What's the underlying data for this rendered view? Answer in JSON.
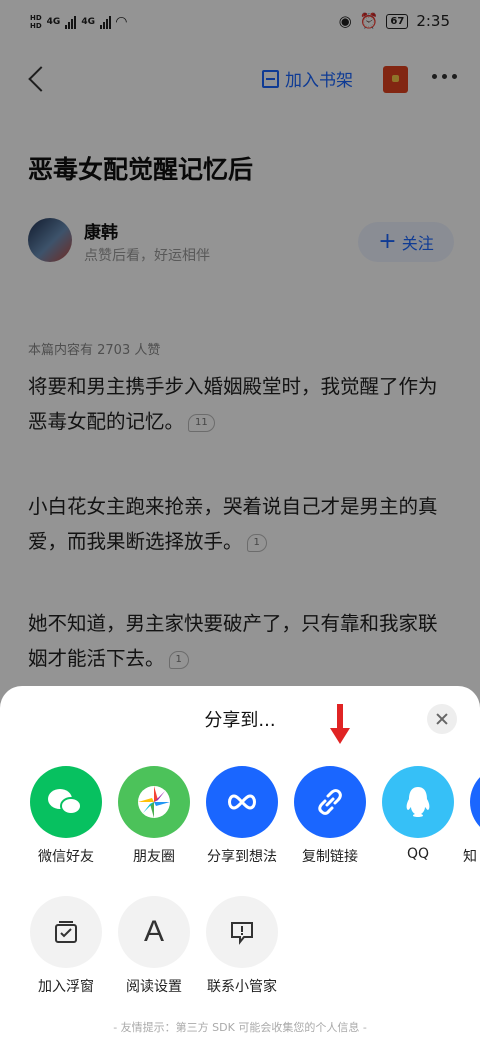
{
  "status_bar": {
    "sim1": "HD",
    "sim2": "HD",
    "net1": "4G",
    "net2": "4G",
    "battery": "67",
    "time": "2:35"
  },
  "nav": {
    "bookshelf_label": "加入书架"
  },
  "article": {
    "title": "恶毒女配觉醒记忆后",
    "author_name": "康韩",
    "author_sub": "点赞后看，好运相伴",
    "follow_label": "关注",
    "likes_text": "本篇内容有 2703 人赞",
    "paragraphs": [
      {
        "text": "将要和男主携手步入婚姻殿堂时，我觉醒了作为恶毒女配的记忆。",
        "comments": "11"
      },
      {
        "text": "小白花女主跑来抢亲，哭着说自己才是男主的真爱，而我果断选择放手。",
        "comments": "1"
      },
      {
        "text": "她不知道，男主家快要破产了，只有靠和我家联姻才能活下去。",
        "comments": "1"
      }
    ]
  },
  "share_sheet": {
    "title": "分享到...",
    "share_items": [
      {
        "label": "微信好友",
        "color": "#07c160"
      },
      {
        "label": "朋友圈",
        "color": "#4cc25a"
      },
      {
        "label": "分享到想法",
        "color": "#1a66ff"
      },
      {
        "label": "复制链接",
        "color": "#1a66ff"
      },
      {
        "label": "QQ",
        "color": "#36c0f7"
      },
      {
        "label": "知",
        "color": "#1a66ff"
      }
    ],
    "tool_items": [
      {
        "label": "加入浮窗"
      },
      {
        "label": "阅读设置"
      },
      {
        "label": "联系小管家"
      }
    ],
    "notice": "- 友情提示：第三方 SDK 可能会收集您的个人信息 -",
    "colors": {
      "accent": "#1a66ff",
      "arrow": "#e02424"
    }
  }
}
